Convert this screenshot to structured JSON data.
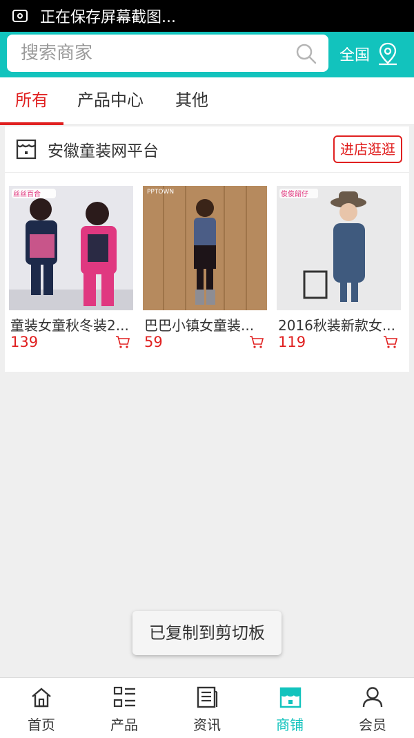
{
  "status_bar": {
    "text": "正在保存屏幕截图..."
  },
  "search": {
    "placeholder": "搜索商家",
    "region_label": "全国"
  },
  "tabs": [
    {
      "label": "所有",
      "active": true
    },
    {
      "label": "产品中心",
      "active": false
    },
    {
      "label": "其他",
      "active": false
    }
  ],
  "shop": {
    "name": "安徽童装网平台",
    "visit_label": "进店逛逛",
    "products": [
      {
        "title": "童装女童秋冬装2...",
        "price": "139",
        "image_text": "丝丝百合"
      },
      {
        "title": "巴巴小镇女童装...",
        "price": "59",
        "image_text": "PPTOWN"
      },
      {
        "title": "2016秋装新款女...",
        "price": "119",
        "image_text": "俊俊韶仔"
      }
    ]
  },
  "toast": {
    "text": "已复制到剪切板"
  },
  "bottom_nav": [
    {
      "label": "首页",
      "icon": "home-icon",
      "active": false
    },
    {
      "label": "产品",
      "icon": "list-icon",
      "active": false
    },
    {
      "label": "资讯",
      "icon": "news-icon",
      "active": false
    },
    {
      "label": "商铺",
      "icon": "shop-icon",
      "active": true
    },
    {
      "label": "会员",
      "icon": "user-icon",
      "active": false
    }
  ],
  "colors": {
    "accent": "#12c3bd",
    "highlight": "#e02020"
  }
}
